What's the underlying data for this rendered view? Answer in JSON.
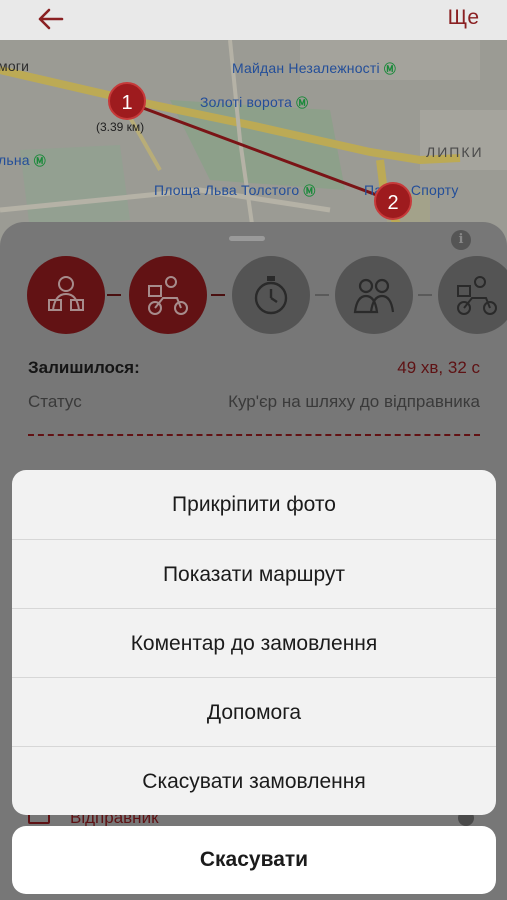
{
  "header": {
    "more_label": "Ще",
    "back_icon": "arrow-left-icon"
  },
  "map": {
    "labels": {
      "street_left": "моги",
      "maidan": "Майдан Незалежності",
      "zoloti_vorota": "Золоті ворота",
      "lypky": "ЛИПКИ",
      "station_left": "льна",
      "lva_tolstoho": "Площа Льва Толстого",
      "palats_sportu": "Палац Спорту"
    },
    "distance": "(3.39 км)",
    "pin_start": "1",
    "pin_end": "2"
  },
  "order": {
    "remaining_label": "Залишилося:",
    "remaining_value": "49 хв, 32 с",
    "status_label": "Статус",
    "status_value": "Кур'єр на шляху до відправника",
    "sender_label": "Відправник"
  },
  "steps": [
    {
      "icon": "courier-with-boxes-icon",
      "state": "done"
    },
    {
      "icon": "scooter-delivery-icon",
      "state": "active"
    },
    {
      "icon": "stopwatch-icon",
      "state": "pending"
    },
    {
      "icon": "people-meeting-icon",
      "state": "pending"
    },
    {
      "icon": "scooter-delivery-icon",
      "state": "pending"
    }
  ],
  "action_sheet": {
    "items": [
      "Прикріпити фото",
      "Показати маршрут",
      "Коментар до замовлення",
      "Допомога",
      "Скасувати замовлення"
    ],
    "cancel_label": "Скасувати"
  },
  "colors": {
    "brand_red": "#9e1b1e",
    "metro_green": "#1a8a3a"
  }
}
